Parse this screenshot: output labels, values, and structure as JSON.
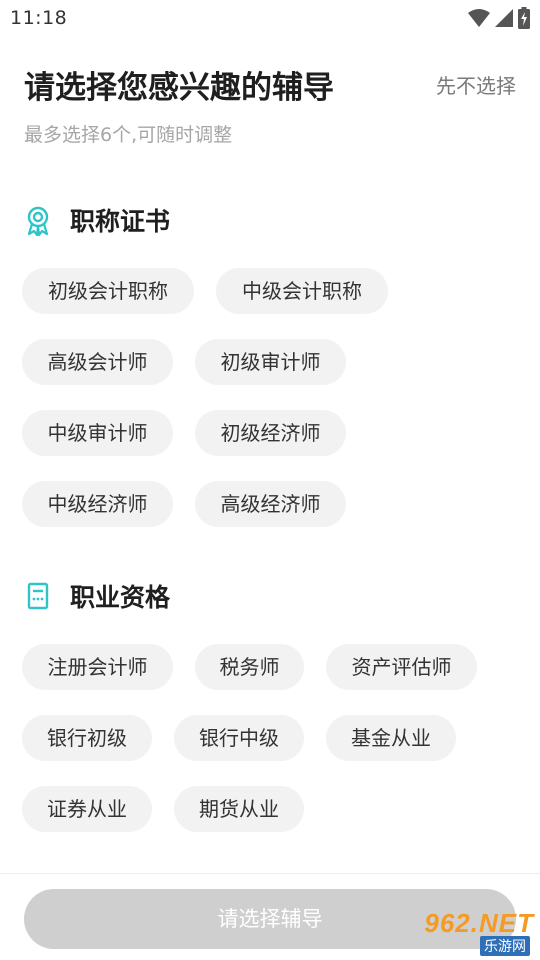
{
  "status_bar": {
    "time": "11:18",
    "icons": [
      "wifi-icon",
      "cellular-signal-icon",
      "battery-charging-icon"
    ]
  },
  "header": {
    "title": "请选择您感兴趣的辅导",
    "skip_label": "先不选择",
    "subtitle": "最多选择6个,可随时调整"
  },
  "sections": [
    {
      "title": "职称证书",
      "icon": "certificate-icon",
      "items": [
        "初级会计职称",
        "中级会计职称",
        "高级会计师",
        "初级审计师",
        "中级审计师",
        "初级经济师",
        "中级经济师",
        "高级经济师"
      ]
    },
    {
      "title": "职业资格",
      "icon": "calculator-icon",
      "items": [
        "注册会计师",
        "税务师",
        "资产评估师",
        "银行初级",
        "银行中级",
        "基金从业",
        "证券从业",
        "期货从业"
      ]
    }
  ],
  "submit_label": "请选择辅导",
  "watermark": {
    "top": "962.NET",
    "bottom": "乐游网"
  },
  "colors": {
    "accent": "#2ec4c8",
    "chip_bg": "#f2f2f2",
    "button_disabled": "#cfcfcf"
  }
}
